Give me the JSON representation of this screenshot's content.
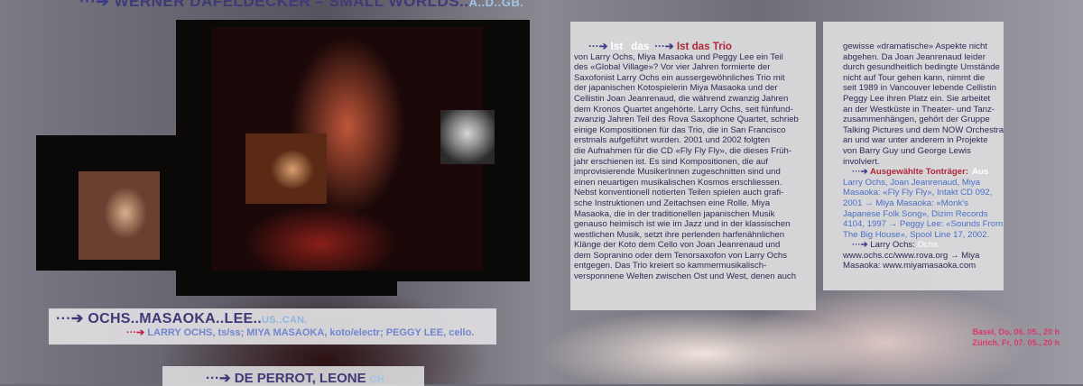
{
  "headers": {
    "top": {
      "arrow": "···➔",
      "title": "WERNER DAFELDECKER – SMALL WORLDS..",
      "suffix": "A..D..GB."
    },
    "main": {
      "arrow": "···➔",
      "title": "OCHS..MASAOKA..LEE..",
      "suffix": "US..CAN."
    },
    "main_subtitle": {
      "arrow": "···➔",
      "text": "LARRY OCHS, ts/ss; MIYA MASAOKA, koto/electr; PEGGY LEE, cello."
    },
    "bottom": {
      "arrow": "···➔",
      "title": "DE PERROT, LEONE",
      "suffix": "CH"
    }
  },
  "article": {
    "heading_muted_1": "Ist",
    "heading_muted_2": "das",
    "heading": "Ist das Trio",
    "lines": [
      "von Larry Ochs, Miya Masaoka und Peggy Lee ein Teil",
      "des «Global Village»? Vor vier Jahren formierte der",
      "Saxofonist Larry Ochs ein aussergewöhnliches Trio mit",
      "der japanischen Kotospielerin Miya Masaoka und der",
      "Cellistin Joan Jeanrenaud, die während zwanzig Jahren",
      "dem Kronos Quartet angehörte. Larry Ochs, seit fünfund-",
      "zwanzig Jahren Teil des Rova Saxophone Quartet, schrieb",
      "einige Kompositionen für das Trio, die in San Francisco",
      "erstmals aufgeführt wurden. 2001 und 2002 folgten",
      "die Aufnahmen für die CD «Fly Fly Fly», die dieses Früh-",
      "jahr erschienen ist. Es sind Kompositionen, die auf",
      "improvisierende MusikerInnen zugeschnitten sind und",
      "einen neuartigen musikalischen Kosmos erschliessen.",
      "Nebst konventionell notierten Teilen spielen auch grafi-",
      "sche Instruktionen und Zeitachsen eine Rolle. Miya",
      "Masaoka, die in der traditionellen japanischen Musik",
      "genauso heimisch ist wie im Jazz und in der klassischen",
      "westlichen Musik, setzt ihre perlenden harfenähnlichen",
      "Klänge der Koto dem Cello von Joan Jeanrenaud und",
      "dem Sopranino oder dem Tenorsaxofon von Larry Ochs",
      "entgegen. Das Trio kreiert so kammermusikalisch-",
      "versponnene Welten zwischen Ost und West, denen auch"
    ]
  },
  "sidecol": {
    "lines": [
      "gewisse «dramatische» Aspekte nicht",
      "abgehen. Da Joan Jeanrenaud leider",
      "durch gesundheitlich bedingte Umstände",
      "nicht auf Tour gehen kann, nimmt die",
      "seit 1989 in Vancouver lebende Cellistin",
      "Peggy Lee ihren Platz ein. Sie arbeitet",
      "an der Westküste in Theater- und Tanz-",
      "zusammenhängen, gehört der Gruppe",
      "Talking Pictures und dem NOW Orchestra",
      "an und war unter anderem in Projekte",
      "von Barry Guy und George Lewis involviert."
    ],
    "discography_heading": "Ausgewählte Tonträger:",
    "discography_heading_muted": "Aus",
    "discography": [
      "Larry Ochs, Joan Jeanrenaud, Miya",
      "Masaoka: «Fly Fly Fly», Intakt CD 092,",
      "2001 → Miya Masaoka: «Monk's",
      "Japanese Folk Song», Dizim Records",
      "4104, 1997 → Peggy Lee: «Sounds From",
      "The Big House», Spool Line 17, 2002."
    ],
    "links_heading": "Larry Ochs:",
    "links_heading_muted": "Ochs",
    "links": [
      "www.ochs.cc/www.rova.org → Miya",
      "Masaoka: www.miyamasaoka.com"
    ]
  },
  "dates": [
    "Basel, Do, 06. 05., 20 h",
    "Zürich, Fr, 07. 05., 20 h"
  ],
  "colors": {
    "heading_blue": "#3e3a78",
    "accent_red": "#b0283a",
    "link_blue": "#4a6fc6",
    "date_pink": "#d83a6a"
  }
}
